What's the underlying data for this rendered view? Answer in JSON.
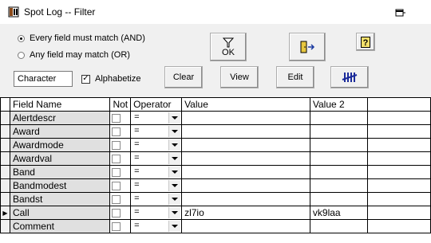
{
  "window": {
    "title": "Spot Log -- Filter"
  },
  "match": {
    "and_label": "Every field must match (AND)",
    "or_label": "Any field may match (OR)",
    "selected": "and"
  },
  "toolbar": {
    "ok_label": "OK",
    "sort_field": "Character",
    "alphabetize_label": "Alphabetize",
    "alphabetize_checked": true,
    "clear_label": "Clear",
    "view_label": "View",
    "edit_label": "Edit"
  },
  "grid": {
    "columns": [
      "Field Name",
      "Not",
      "Operator",
      "Value",
      "Value 2"
    ],
    "rows": [
      {
        "field": "Alertdescr",
        "op": "=",
        "value": "",
        "value2": ""
      },
      {
        "field": "Award",
        "op": "=",
        "value": "",
        "value2": ""
      },
      {
        "field": "Awardmode",
        "op": "=",
        "value": "",
        "value2": ""
      },
      {
        "field": "Awardval",
        "op": "=",
        "value": "",
        "value2": ""
      },
      {
        "field": "Band",
        "op": "=",
        "value": "",
        "value2": ""
      },
      {
        "field": "Bandmodest",
        "op": "=",
        "value": "",
        "value2": ""
      },
      {
        "field": "Bandst",
        "op": "=",
        "value": "",
        "value2": ""
      },
      {
        "field": "Call",
        "op": "=",
        "value": "zl7io",
        "value2": "vk9laa",
        "current": true
      },
      {
        "field": "Comment",
        "op": "=",
        "value": "",
        "value2": ""
      }
    ]
  },
  "icons": {
    "app": "spot-log-app-icon",
    "restore": "restore-window-icon",
    "ok": "funnel-icon",
    "exit": "exit-door-icon",
    "help": "help-icon",
    "tally": "tally-marks-icon"
  }
}
